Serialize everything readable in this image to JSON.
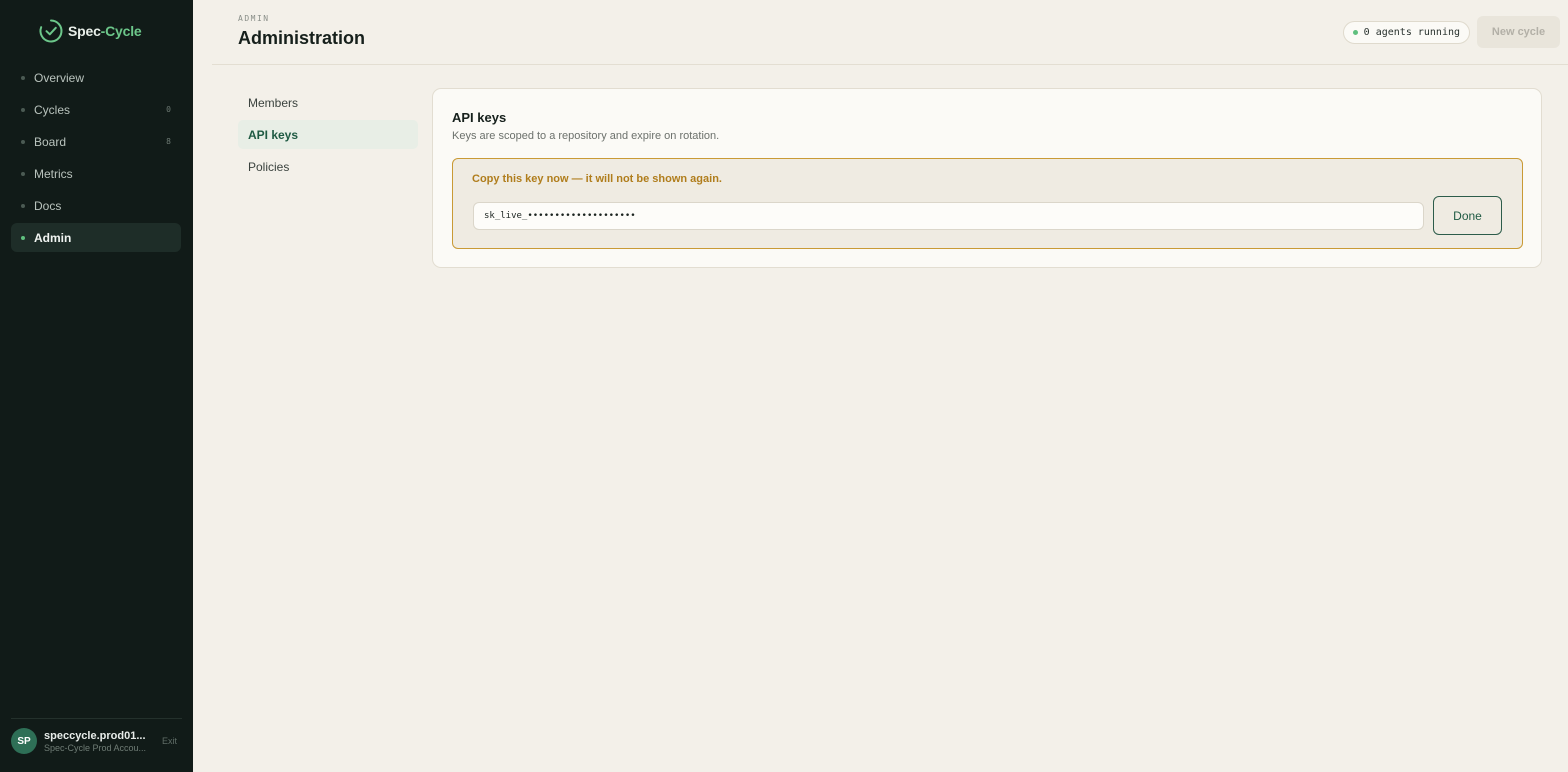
{
  "brand": {
    "name_part1": "Spec",
    "name_part2": "-Cycle",
    "accent_color": "#6cc78a"
  },
  "sidebar": {
    "items": [
      {
        "label": "Overview",
        "count": "",
        "active": false
      },
      {
        "label": "Cycles",
        "count": "0",
        "active": false
      },
      {
        "label": "Board",
        "count": "8",
        "active": false
      },
      {
        "label": "Metrics",
        "count": "",
        "active": false
      },
      {
        "label": "Docs",
        "count": "",
        "active": false
      },
      {
        "label": "Admin",
        "count": "",
        "active": true
      }
    ],
    "user": {
      "initials": "SP",
      "name": "speccycle.prod01...",
      "account": "Spec-Cycle Prod Accou...",
      "exit_label": "Exit"
    }
  },
  "header": {
    "eyebrow": "ADMIN",
    "title": "Administration",
    "agents_status": "0 agents running",
    "new_cycle_label": "New cycle"
  },
  "subnav": {
    "items": [
      {
        "label": "Members",
        "active": false
      },
      {
        "label": "API keys",
        "active": true
      },
      {
        "label": "Policies",
        "active": false
      }
    ]
  },
  "api_keys": {
    "title": "API keys",
    "subtitle": "Keys are scoped to a repository and expire on rotation.",
    "alert_text": "Copy this key now — it will not be shown again.",
    "key_value": "sk_live_••••••••••••••••••••",
    "done_label": "Done",
    "alert_border_color": "#c99a35"
  }
}
